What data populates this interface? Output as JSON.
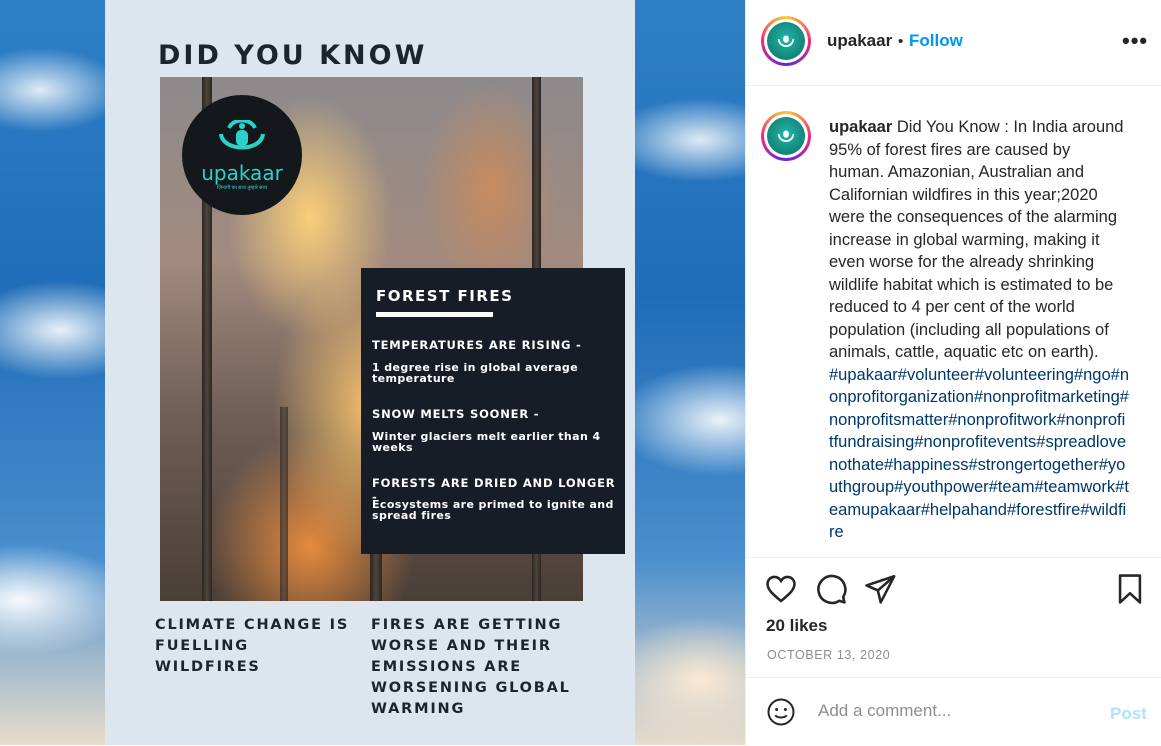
{
  "post": {
    "poster": {
      "title": "DID YOU KNOW",
      "logo_word": "upakaar",
      "logo_tagline": "ज़िन्दगी का साथ तुम्हारे साथ",
      "box_title": "FOREST FIRES",
      "facts": [
        {
          "heading": "TEMPERATURES ARE RISING -",
          "text": "1 degree rise in global average temperature"
        },
        {
          "heading": "SNOW MELTS SOONER -",
          "text": "Winter glaciers melt earlier than 4 weeks"
        },
        {
          "heading": "FORESTS ARE DRIED AND LONGER -",
          "text": "Ecosystems are primed to ignite and spread fires"
        }
      ],
      "caption_left": "CLIMATE CHANGE IS FUELLING WILDFIRES",
      "caption_right": "FIRES ARE GETTING WORSE AND THEIR EMISSIONS ARE WORSENING GLOBAL WARMING"
    }
  },
  "header": {
    "username": "upakaar",
    "separator": "•",
    "follow_label": "Follow",
    "more_label": "•••"
  },
  "caption": {
    "username": "upakaar",
    "text": "Did You Know : In India around 95% of forest fires are caused by human. Amazonian, Australian and Californian wildfires in this year;2020 were the consequences of the alarming increase in global warming, making it even worse for the already shrinking wildlife habitat which is estimated to be reduced to 4 per cent of the world population (including all populations of animals, cattle, aquatic etc on earth).",
    "hashtags": "#upakaar#volunteer#volunteering#ngo#nonprofitorganization#nonprofitmarketing#nonprofitsmatter#nonprofitwork#nonprofitfundraising#nonprofitevents#spreadlovenothate#happiness#strongertogether#youthgroup#youthpower#team#teamwork#teamupakaar#helpahand#forestfire#wildfire"
  },
  "actions": {
    "likes": "20 likes",
    "date": "OCTOBER 13, 2020"
  },
  "comment_box": {
    "placeholder": "Add a comment...",
    "post_label": "Post"
  },
  "colors": {
    "link": "#0095f6",
    "hashtag": "#00376b",
    "post_disabled": "#b2dffc",
    "logo_teal": "#2ad3c7"
  }
}
